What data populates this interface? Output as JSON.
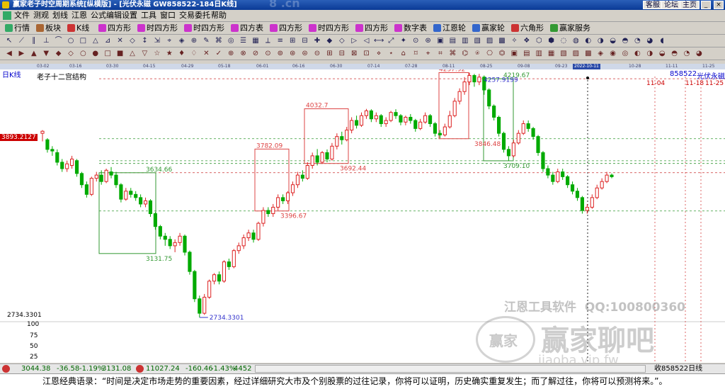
{
  "window": {
    "title": "赢家老子时空周期系统[纵横版] - [光伏永磁  GW858522-184日K线]",
    "watermark_top": "8 .cn",
    "right_buttons": [
      "客服",
      "论坛",
      "主页"
    ]
  },
  "menu": [
    "文件",
    "测观",
    "划线",
    "江恩",
    "公式编辑",
    "设置",
    "工具",
    "窗口",
    "交易委托",
    "帮助"
  ],
  "toolbar1": [
    {
      "label": "行情",
      "color": "#3a6"
    },
    {
      "label": "板块",
      "color": "#a63"
    },
    {
      "label": "K线",
      "color": "#c33"
    },
    {
      "label": "四方形",
      "color": "#c3c"
    },
    {
      "label": "时四方形",
      "color": "#c3c"
    },
    {
      "label": "时四方形",
      "color": "#c3c"
    },
    {
      "label": "四方表",
      "color": "#c3c"
    },
    {
      "label": "四方形",
      "color": "#c3c"
    },
    {
      "label": "时四方形",
      "color": "#c3c"
    },
    {
      "label": "四方形",
      "color": "#c3c"
    },
    {
      "label": "数字表",
      "color": "#c3c"
    },
    {
      "label": "江恩轮",
      "color": "#36c"
    },
    {
      "label": "赢家轮",
      "color": "#36c"
    },
    {
      "label": "六角形",
      "color": "#c33"
    },
    {
      "label": "赢家服务",
      "color": "#393"
    }
  ],
  "timeaxis": [
    {
      "t": "03-02",
      "x": 52
    },
    {
      "t": "03-16",
      "x": 98
    },
    {
      "t": "03-30",
      "x": 150
    },
    {
      "t": "04-15",
      "x": 202
    },
    {
      "t": "04-29",
      "x": 256
    },
    {
      "t": "05-18",
      "x": 308
    },
    {
      "t": "06-01",
      "x": 362
    },
    {
      "t": "06-16",
      "x": 413
    },
    {
      "t": "06-30",
      "x": 466
    },
    {
      "t": "07-14",
      "x": 519
    },
    {
      "t": "07-28",
      "x": 572
    },
    {
      "t": "08-11",
      "x": 625
    },
    {
      "t": "08-25",
      "x": 678
    },
    {
      "t": "09-08",
      "x": 731
    },
    {
      "t": "09-23",
      "x": 784
    },
    {
      "t": "2022-10-11",
      "x": 809,
      "hl": true
    },
    {
      "t": "10-28",
      "x": 888
    },
    {
      "t": "11-11",
      "x": 940
    },
    {
      "t": "11-25",
      "x": 992
    }
  ],
  "chart": {
    "period_label": "日K线",
    "subtitle": "老子十二宫结构",
    "stock_code": "858522",
    "stock_name": "光伏永磁",
    "price_label_left": "3893.2127",
    "low_label_left": "2734.3301",
    "low_marker": "2734.3301",
    "future_date_1": "11-04",
    "future_date_2": "11-18",
    "future_date_3": "11-25",
    "y_ticks": [
      "100",
      "75",
      "50",
      "25"
    ],
    "watermark_line1": "江恩工具软件  QQ:100800360",
    "watermark_line2": "赢家聊吧",
    "watermark_line3": "jiaoba.vip.fw",
    "watermark_logo": "赢家"
  },
  "boxes": [
    {
      "color": "green",
      "hi": 3634.66,
      "lo": 3131.75,
      "hi_label": "3634.66",
      "lo_label": "3131.75"
    },
    {
      "color": "red",
      "hi": 3782.09,
      "lo": 3396.67,
      "hi_label": "3782.09",
      "lo_label": "3396.67"
    },
    {
      "color": "red",
      "hi": 4032.7,
      "lo": 3692.44,
      "hi_label": "4032.7",
      "lo_label": "3692.44"
    },
    {
      "color": "red",
      "hi": 4257.92,
      "lo": 3846.48,
      "hi_label": "4257.92",
      "lo_label": "3846.48"
    },
    {
      "color": "green",
      "hi": 4219.67,
      "lo": 3709.1,
      "hi_label": "4219.67",
      "lo_label": "3709.10"
    },
    {
      "color": "blue",
      "hi": 4257.9199,
      "hi_label": "4257.9199"
    }
  ],
  "status": {
    "idx1": "3044.38",
    "chg1": "-36.58",
    "pct1": "-1.19%",
    "val1": "3131.08",
    "idx2": "11027.24",
    "chg2": "-160.46",
    "pct2": "-1.43%",
    "val2": "4452",
    "right": "收858522日线"
  },
  "quote": "江恩经典语录：“时间是决定市场走势的重要因素，经过详细研究大市及个别股票的过往记录，你将可以证明，历史确实重复发生；而了解过往，你将可以预测将来。”。",
  "candles": [
    [
      3880,
      3893,
      3830,
      3900
    ],
    [
      3840,
      3780,
      3760,
      3850
    ],
    [
      3780,
      3770,
      3740,
      3800
    ],
    [
      3760,
      3700,
      3680,
      3780
    ],
    [
      3700,
      3660,
      3640,
      3720
    ],
    [
      3660,
      3690,
      3640,
      3710
    ],
    [
      3680,
      3720,
      3660,
      3740
    ],
    [
      3710,
      3630,
      3610,
      3720
    ],
    [
      3630,
      3560,
      3540,
      3640
    ],
    [
      3560,
      3500,
      3480,
      3580
    ],
    [
      3500,
      3600,
      3490,
      3610
    ],
    [
      3600,
      3620,
      3580,
      3640
    ],
    [
      3620,
      3580,
      3560,
      3650
    ],
    [
      3580,
      3650,
      3570,
      3660
    ],
    [
      3640,
      3620,
      3600,
      3670
    ],
    [
      3620,
      3560,
      3540,
      3640
    ],
    [
      3560,
      3470,
      3450,
      3570
    ],
    [
      3470,
      3520,
      3460,
      3540
    ],
    [
      3520,
      3500,
      3480,
      3540
    ],
    [
      3500,
      3480,
      3460,
      3520
    ],
    [
      3480,
      3440,
      3420,
      3500
    ],
    [
      3440,
      3460,
      3420,
      3480
    ],
    [
      3460,
      3380,
      3360,
      3470
    ],
    [
      3380,
      3300,
      3280,
      3390
    ],
    [
      3300,
      3240,
      3220,
      3310
    ],
    [
      3240,
      3220,
      3180,
      3260
    ],
    [
      3220,
      3180,
      3160,
      3240
    ],
    [
      3180,
      3200,
      3140,
      3220
    ],
    [
      3200,
      3240,
      3180,
      3260
    ],
    [
      3240,
      3140,
      3120,
      3250
    ],
    [
      3140,
      3020,
      3000,
      3150
    ],
    [
      3020,
      2850,
      2830,
      3030
    ],
    [
      2850,
      2760,
      2734,
      2870
    ],
    [
      2760,
      2860,
      2750,
      2880
    ],
    [
      2860,
      2960,
      2850,
      2970
    ],
    [
      2960,
      3000,
      2940,
      3010
    ],
    [
      3000,
      2960,
      2940,
      3020
    ],
    [
      2960,
      3080,
      2950,
      3090
    ],
    [
      3080,
      3050,
      3030,
      3100
    ],
    [
      3050,
      3150,
      3040,
      3160
    ],
    [
      3150,
      3180,
      3130,
      3200
    ],
    [
      3180,
      3230,
      3160,
      3250
    ],
    [
      3230,
      3260,
      3210,
      3280
    ],
    [
      3260,
      3220,
      3200,
      3280
    ],
    [
      3220,
      3320,
      3210,
      3330
    ],
    [
      3320,
      3400,
      3300,
      3420
    ],
    [
      3400,
      3380,
      3360,
      3420
    ],
    [
      3380,
      3420,
      3360,
      3440
    ],
    [
      3420,
      3480,
      3400,
      3500
    ],
    [
      3480,
      3460,
      3440,
      3500
    ],
    [
      3460,
      3510,
      3440,
      3520
    ],
    [
      3510,
      3560,
      3490,
      3580
    ],
    [
      3560,
      3620,
      3540,
      3640
    ],
    [
      3620,
      3600,
      3580,
      3650
    ],
    [
      3600,
      3680,
      3590,
      3700
    ],
    [
      3680,
      3740,
      3660,
      3760
    ],
    [
      3740,
      3700,
      3680,
      3782
    ],
    [
      3700,
      3760,
      3690,
      3770
    ],
    [
      3760,
      3720,
      3700,
      3780
    ],
    [
      3720,
      3800,
      3710,
      3820
    ],
    [
      3800,
      3860,
      3780,
      3880
    ],
    [
      3860,
      3840,
      3810,
      3890
    ],
    [
      3840,
      3900,
      3830,
      3920
    ],
    [
      3900,
      3960,
      3880,
      3980
    ],
    [
      3960,
      3930,
      3910,
      3990
    ],
    [
      3930,
      3990,
      3920,
      4010
    ],
    [
      3990,
      4020,
      3970,
      4032
    ],
    [
      4020,
      3970,
      3950,
      4030
    ],
    [
      3970,
      3990,
      3950,
      4010
    ],
    [
      3990,
      3940,
      3920,
      4000
    ],
    [
      3940,
      3960,
      3920,
      3980
    ],
    [
      3960,
      4010,
      3950,
      4020
    ],
    [
      4010,
      3990,
      3970,
      4030
    ],
    [
      3990,
      3950,
      3930,
      4000
    ],
    [
      3950,
      3980,
      3930,
      3990
    ],
    [
      3980,
      3960,
      3940,
      4000
    ],
    [
      3960,
      3910,
      3890,
      3970
    ],
    [
      3910,
      3950,
      3900,
      3970
    ],
    [
      3950,
      3990,
      3940,
      4010
    ],
    [
      3990,
      3940,
      3920,
      4000
    ],
    [
      3940,
      3880,
      3860,
      3950
    ],
    [
      3880,
      3870,
      3850,
      3900
    ],
    [
      3870,
      3920,
      3860,
      3940
    ],
    [
      3920,
      3990,
      3910,
      4020
    ],
    [
      3990,
      4080,
      3980,
      4100
    ],
    [
      4080,
      4140,
      4060,
      4160
    ],
    [
      4140,
      4200,
      4120,
      4230
    ],
    [
      4200,
      4240,
      4180,
      4257
    ],
    [
      4240,
      4200,
      4170,
      4250
    ],
    [
      4200,
      4230,
      4180,
      4250
    ],
    [
      4230,
      4150,
      4120,
      4240
    ],
    [
      4150,
      4050,
      4030,
      4160
    ],
    [
      4050,
      3980,
      3960,
      4060
    ],
    [
      3980,
      3880,
      3860,
      3990
    ],
    [
      3880,
      3780,
      3760,
      3890
    ],
    [
      3780,
      3740,
      3709,
      3800
    ],
    [
      3740,
      3820,
      3730,
      3840
    ],
    [
      3820,
      3880,
      3810,
      3900
    ],
    [
      3880,
      3940,
      3870,
      3960
    ],
    [
      3940,
      3910,
      3890,
      3960
    ],
    [
      3910,
      3860,
      3840,
      3920
    ],
    [
      3860,
      3760,
      3740,
      3870
    ],
    [
      3760,
      3660,
      3640,
      3770
    ],
    [
      3660,
      3620,
      3600,
      3680
    ],
    [
      3620,
      3580,
      3560,
      3640
    ],
    [
      3580,
      3640,
      3570,
      3660
    ],
    [
      3640,
      3610,
      3590,
      3660
    ],
    [
      3610,
      3560,
      3540,
      3620
    ],
    [
      3560,
      3520,
      3500,
      3580
    ],
    [
      3520,
      3480,
      3460,
      3540
    ],
    [
      3480,
      3400,
      3380,
      3490
    ],
    [
      3400,
      3420,
      3380,
      3440
    ],
    [
      3420,
      3480,
      3410,
      3500
    ],
    [
      3480,
      3540,
      3470,
      3560
    ],
    [
      3540,
      3580,
      3530,
      3600
    ],
    [
      3580,
      3620,
      3570,
      3640
    ],
    [
      3620,
      3610,
      3600,
      3630
    ]
  ]
}
